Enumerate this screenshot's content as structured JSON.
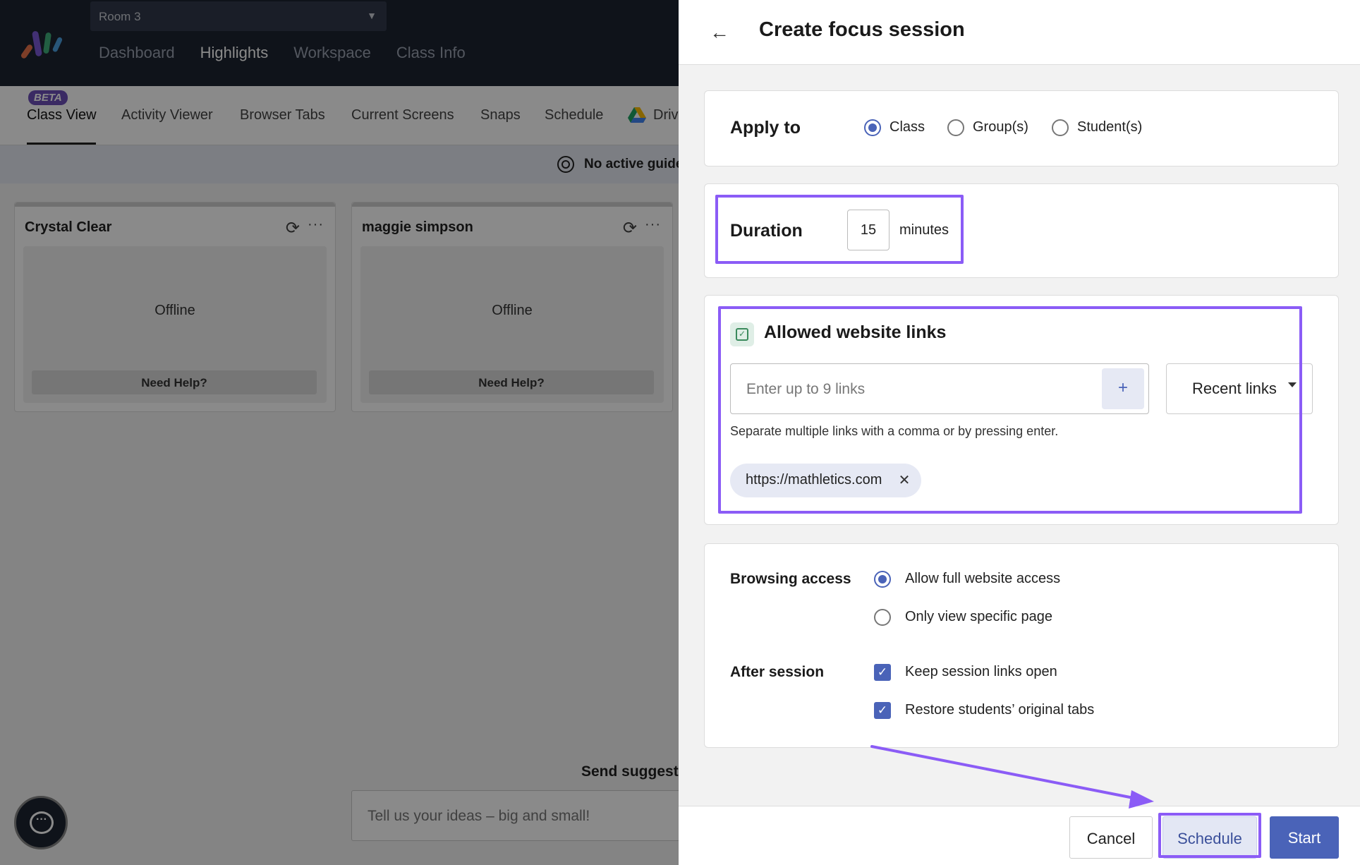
{
  "app": {
    "room_select": "Room 3",
    "main_nav": [
      "Dashboard",
      "Highlights",
      "Workspace",
      "Class Info"
    ],
    "main_nav_active": "Highlights",
    "beta_badge": "BETA",
    "sub_tabs": [
      "Class View",
      "Activity Viewer",
      "Browser Tabs",
      "Current Screens",
      "Snaps",
      "Schedule",
      "Driv"
    ],
    "guide_status": "No active guide",
    "students": [
      {
        "name": "Crystal Clear",
        "status": "Offline",
        "help": "Need Help?"
      },
      {
        "name": "maggie simpson",
        "status": "Offline",
        "help": "Need Help?"
      }
    ],
    "suggest_title": "Send suggesti",
    "suggest_placeholder": "Tell us your ideas – big and small!"
  },
  "panel": {
    "title": "Create focus session",
    "apply_to": {
      "label": "Apply to",
      "options": [
        "Class",
        "Group(s)",
        "Student(s)"
      ],
      "selected": "Class"
    },
    "duration": {
      "label": "Duration",
      "value": "15",
      "unit": "minutes"
    },
    "links": {
      "title": "Allowed website links",
      "placeholder": "Enter up to 9 links",
      "add_symbol": "+",
      "recent_label": "Recent links",
      "hint": "Separate multiple links with a comma or by pressing enter.",
      "items": [
        "https://mathletics.com"
      ],
      "remove_symbol": "✕"
    },
    "browsing": {
      "label": "Browsing access",
      "options": [
        "Allow full website access",
        "Only view specific page"
      ],
      "selected": "Allow full website access"
    },
    "after": {
      "label": "After session",
      "options": [
        {
          "label": "Keep session links open",
          "checked": true
        },
        {
          "label": "Restore students’ original tabs",
          "checked": true
        }
      ]
    },
    "buttons": {
      "cancel": "Cancel",
      "schedule": "Schedule",
      "start": "Start"
    }
  },
  "colors": {
    "accent": "#4a63b8",
    "highlight": "#8b5cf6",
    "topbar": "#1d2431"
  },
  "icons": {
    "back": "arrow-left-icon",
    "refresh": "refresh-icon",
    "more": "more-horizontal-icon",
    "target": "target-icon",
    "chat": "chat-bubble-icon",
    "drive": "google-drive-icon",
    "links": "calendar-check-icon"
  }
}
